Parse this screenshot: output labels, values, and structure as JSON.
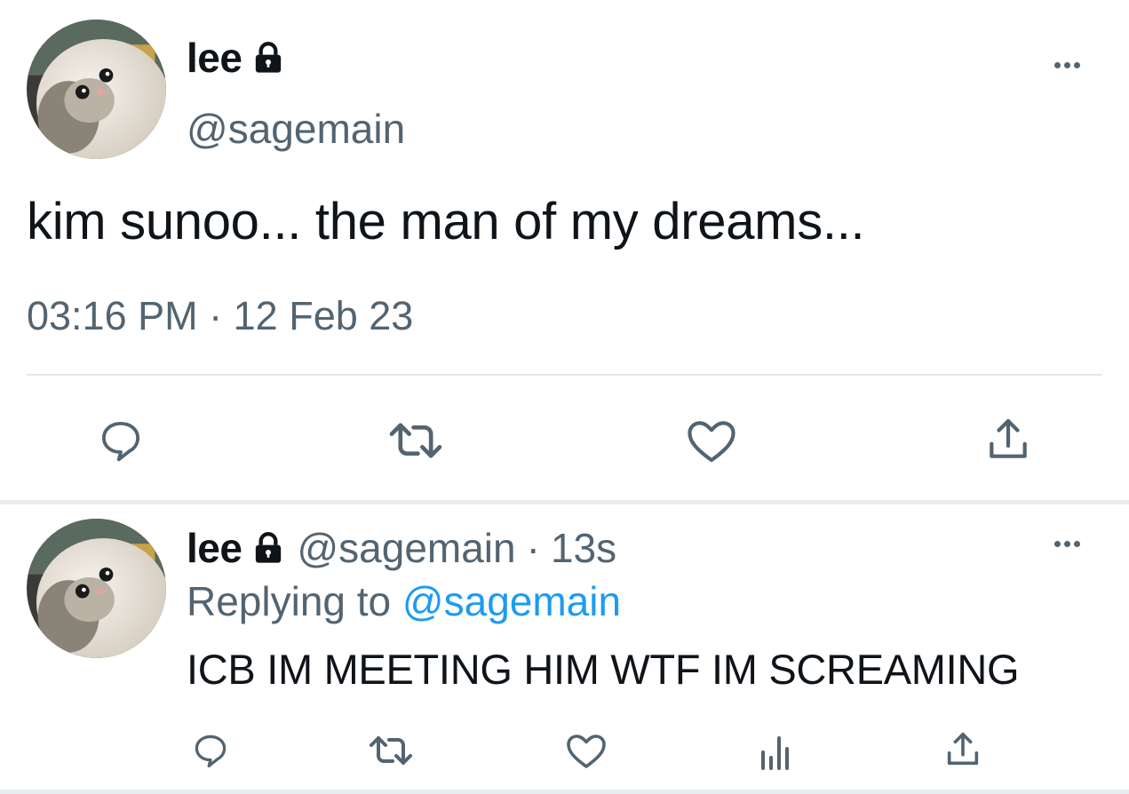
{
  "tweet": {
    "display_name": "lee",
    "handle": "@sagemain",
    "text": "kim sunoo... the man of my dreams...",
    "time": "03:16 PM",
    "separator": "·",
    "date": "12 Feb 23",
    "icons": [
      "reply-icon",
      "retweet-icon",
      "like-icon",
      "share-icon"
    ]
  },
  "reply": {
    "display_name": "lee",
    "handle": "@sagemain",
    "separator": "·",
    "age": "13s",
    "replying_prefix": "Replying to",
    "replying_handle": "@sagemain",
    "text": "ICB IM MEETING HIM WTF IM SCREAMING",
    "icons": [
      "reply-icon",
      "retweet-icon",
      "like-icon",
      "analytics-icon",
      "share-icon"
    ]
  },
  "colors": {
    "text": "#0f1419",
    "muted": "#536471",
    "link": "#1d9bf0",
    "divider": "#e1e8ed"
  }
}
